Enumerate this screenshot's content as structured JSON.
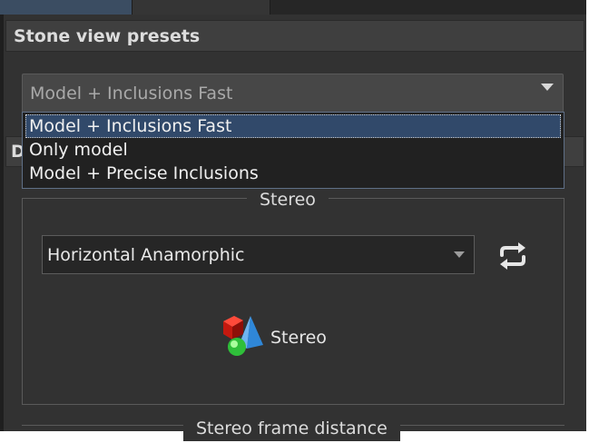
{
  "section": {
    "title": "Stone view presets"
  },
  "preset_combo": {
    "selected": "Model + Inclusions Fast",
    "options": [
      "Model + Inclusions Fast",
      "Only model",
      "Model + Precise Inclusions"
    ]
  },
  "section2": {
    "title_fragment": "D"
  },
  "stereo": {
    "group_title": "Stereo",
    "mode_selected": "Horizontal Anamorphic",
    "button_label": "Stereo"
  },
  "frame_distance": {
    "group_title": "Stereo frame distance"
  },
  "colors": {
    "panel": "#323232",
    "accent": "#31496a",
    "popup_border": "#5f6f86"
  },
  "icons": {
    "swap": "swap-arrows-icon",
    "stereo": "stereo-shapes-icon",
    "dropdown": "chevron-down-icon"
  }
}
